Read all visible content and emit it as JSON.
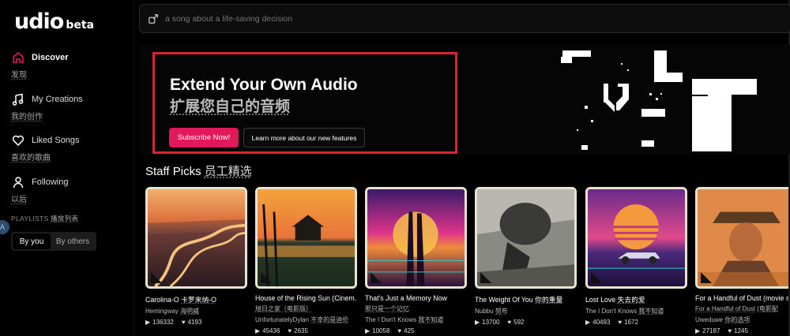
{
  "logo": {
    "name": "udio",
    "badge": "beta"
  },
  "search": {
    "placeholder": "a song about a life-saving decision"
  },
  "nav": [
    {
      "label": "Discover",
      "zh": "发现"
    },
    {
      "label": "My Creations",
      "zh": "我的创作"
    },
    {
      "label": "Liked Songs",
      "zh": "喜欢的歌曲"
    },
    {
      "label": "Following",
      "zh": "以后"
    }
  ],
  "playlists": {
    "label": "PLAYLISTS",
    "zh": "播放列表",
    "by_you": "By you",
    "by_others": "By others"
  },
  "avatar_letter": "A",
  "banner": {
    "title": "Extend Your Own Audio",
    "title_zh": "扩展您自己的音频",
    "subscribe": "Subscribe Now!",
    "learn_more": "Learn more about our new features"
  },
  "staff_picks": {
    "label": "Staff Picks",
    "zh": "员工精选"
  },
  "cards": [
    {
      "title": "Carolina-O",
      "title_zh": "卡罗来纳-O",
      "artist": "Hemingway",
      "artist_zh": "海明威",
      "plays": "136332",
      "likes": "4193"
    },
    {
      "title": "House of the Rising Sun (Cinem...",
      "title_zh": "旭日之家（电影版）",
      "artist": "UnfortunatelyDylan",
      "artist_zh": "不幸的是迪伦",
      "plays": "45436",
      "likes": "2635"
    },
    {
      "title": "That's Just a Memory Now",
      "title_zh": "那只是一个记忆",
      "artist": "The I Don't Knows",
      "artist_zh": "我不知道",
      "plays": "10058",
      "likes": "425"
    },
    {
      "title": "The Weight Of You",
      "title_zh": "你的重量",
      "artist": "Nubbu",
      "artist_zh": "努布",
      "plays": "13700",
      "likes": "592"
    },
    {
      "title": "Lost Love",
      "title_zh": "失去的爱",
      "artist": "The I Don't Knows",
      "artist_zh": "我不知道",
      "plays": "40493",
      "likes": "1672"
    },
    {
      "title": "For a Handful of Dust (movie so",
      "title_zh": "",
      "artist": "For a Handful of Dust",
      "artist_zh": "(电影配",
      "artist2": "Uweduwe",
      "artist2_zh": "你的选项",
      "plays": "27187",
      "likes": "1245"
    }
  ],
  "colors": {
    "accent": "#e0195a",
    "highlight_box": "#d9252e",
    "background": "#000000"
  }
}
